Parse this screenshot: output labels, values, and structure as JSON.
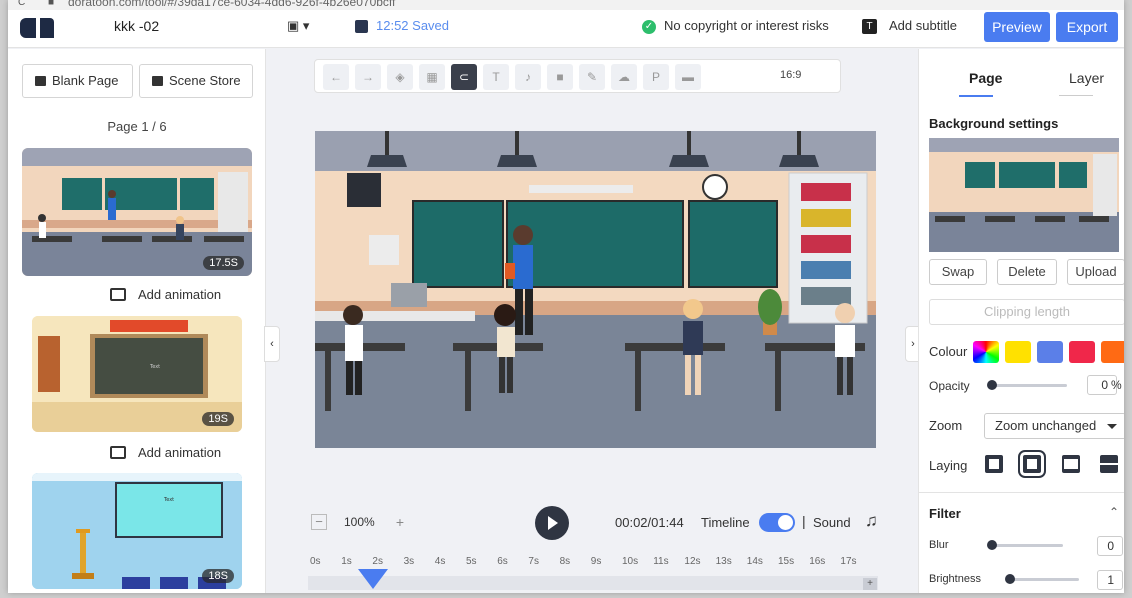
{
  "browser": {
    "url": "doratoon.com/tool/#/39da17ce-6034-4dd6-926f-4b26e070bcff"
  },
  "header": {
    "project_name": "kkk -02",
    "save_status": "12:52 Saved",
    "copyright_status": "No copyright or interest risks",
    "add_subtitle": "Add subtitle",
    "preview": "Preview",
    "export": "Export",
    "accent_color": "#4a7cf0"
  },
  "left_panel": {
    "blank_page": "Blank Page",
    "scene_store": "Scene Store",
    "page_indicator": "Page 1 / 6",
    "pages": [
      {
        "duration": "17.5S",
        "add_animation": "Add animation"
      },
      {
        "duration": "19S",
        "add_animation": "Add animation"
      },
      {
        "duration": "18S"
      }
    ]
  },
  "toolbar": {
    "tools": [
      "undo-icon",
      "redo-icon",
      "layers-icon",
      "grid-icon",
      "magnet-icon",
      "format-brush-icon",
      "microphone-icon",
      "camera-icon",
      "pen-icon",
      "cloud-icon",
      "p-icon",
      "screen-icon"
    ],
    "active_tool": "magnet-icon",
    "aspect_ratio": "16:9"
  },
  "timeline": {
    "zoom": "100%",
    "time": "00:02/01:44",
    "timeline_label": "Timeline",
    "timeline_on": true,
    "separator": "|",
    "sound_label": "Sound",
    "ruler": [
      "0s",
      "1s",
      "2s",
      "3s",
      "4s",
      "5s",
      "6s",
      "7s",
      "8s",
      "9s",
      "10s",
      "11s",
      "12s",
      "13s",
      "14s",
      "15s",
      "16s",
      "17s"
    ],
    "plus": "+"
  },
  "right_panel": {
    "tabs": [
      "Page",
      "Layer"
    ],
    "active_tab": "Page",
    "background_settings": "Background settings",
    "swap": "Swap",
    "delete": "Delete",
    "upload": "Upload",
    "clipping_length": "Clipping length",
    "colour_label": "Colour",
    "colours": [
      "#ffe100",
      "#5b7fe8",
      "#f0274a",
      "#ff6a14"
    ],
    "opacity_label": "Opacity",
    "opacity_value": "0",
    "opacity_unit": "%",
    "zoom_label": "Zoom",
    "zoom_value": "Zoom unchanged",
    "laying_label": "Laying",
    "filter_label": "Filter",
    "blur_label": "Blur",
    "blur_value": "0",
    "brightness_label": "Brightness",
    "brightness_value": "1"
  }
}
